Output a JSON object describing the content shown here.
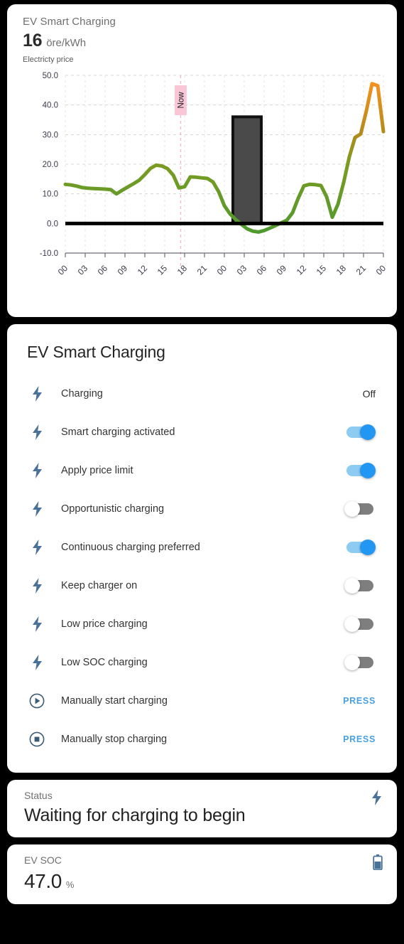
{
  "chart_card": {
    "title": "EV Smart Charging",
    "price_value": "16",
    "price_unit": "öre/kWh",
    "caption": "Electricty price",
    "now_label": "Now"
  },
  "chart_data": {
    "type": "line",
    "title": "Electricty price",
    "xlabel": "",
    "ylabel": "öre/kWh",
    "ylim": [
      -10,
      50
    ],
    "yticks": [
      "50.0",
      "40.0",
      "30.0",
      "20.0",
      "10.0",
      "0.0",
      "-10.0"
    ],
    "ytick_values": [
      50,
      40,
      30,
      20,
      10,
      0,
      -10
    ],
    "xticks": [
      "00",
      "03",
      "06",
      "09",
      "12",
      "15",
      "18",
      "21",
      "00",
      "03",
      "06",
      "09",
      "12",
      "15",
      "18",
      "21",
      "00"
    ],
    "grid": true,
    "legend": "none",
    "line_color_low": "#4f9a2f",
    "line_color_high": "#f5911e",
    "now_marker": {
      "label": "Now",
      "x_hour": "17",
      "line_color": "#f0b6c4",
      "label_bg": "#f9c6d6"
    },
    "charge_bar": {
      "color": "#4a4a4a",
      "edge_color": "#111111",
      "start_hour": "23",
      "end_hour": "03",
      "value": 36
    },
    "series": [
      {
        "name": "Electricity price",
        "x": [
          0,
          1,
          2,
          3,
          4,
          5,
          6,
          7,
          8,
          9,
          10,
          11,
          12,
          13,
          14,
          15,
          16,
          17,
          18,
          19,
          20,
          21,
          22,
          23,
          24,
          25,
          26,
          27,
          28,
          29,
          30,
          31,
          32,
          33,
          34,
          35,
          36,
          37,
          38,
          39,
          40,
          41,
          42,
          43,
          44,
          45,
          46,
          47,
          48
        ],
        "values": [
          13.2,
          13.0,
          12.6,
          12.1,
          11.9,
          11.8,
          11.7,
          11.6,
          11.4,
          10.0,
          11.2,
          12.3,
          13.4,
          14.6,
          16.5,
          18.6,
          19.7,
          19.4,
          18.5,
          16.3,
          12.0,
          12.4,
          15.7,
          15.6,
          15.4,
          15.2,
          14.0,
          10.7,
          6.0,
          3.2,
          1.3,
          -0.3,
          -1.8,
          -2.6,
          -2.9,
          -2.4,
          -1.6,
          -0.7,
          0.2,
          1.1,
          3.6,
          8.5,
          12.7,
          13.2,
          13.1,
          12.8,
          9.0,
          2.1,
          6.5
        ]
      },
      {
        "name": "Electricity price (continued)",
        "x": [
          48,
          49,
          50,
          51,
          52,
          53,
          54,
          55,
          56
        ],
        "values": [
          6.5,
          13.8,
          22.5,
          29.0,
          30.2,
          38.0,
          47.2,
          46.5,
          31.0
        ]
      }
    ]
  },
  "settings_card": {
    "title": "EV Smart Charging",
    "rows": [
      {
        "icon": "lightning-bolt-icon",
        "label": "Charging",
        "control": "text",
        "value": "Off"
      },
      {
        "icon": "lightning-bolt-icon",
        "label": "Smart charging activated",
        "control": "toggle",
        "state": "on"
      },
      {
        "icon": "lightning-bolt-icon",
        "label": "Apply price limit",
        "control": "toggle",
        "state": "on"
      },
      {
        "icon": "lightning-bolt-icon",
        "label": "Opportunistic charging",
        "control": "toggle",
        "state": "off"
      },
      {
        "icon": "lightning-bolt-icon",
        "label": "Continuous charging preferred",
        "control": "toggle",
        "state": "on"
      },
      {
        "icon": "lightning-bolt-icon",
        "label": "Keep charger on",
        "control": "toggle",
        "state": "off"
      },
      {
        "icon": "lightning-bolt-icon",
        "label": "Low price charging",
        "control": "toggle",
        "state": "off"
      },
      {
        "icon": "lightning-bolt-icon",
        "label": "Low SOC charging",
        "control": "toggle",
        "state": "off"
      },
      {
        "icon": "play-circle-icon",
        "label": "Manually start charging",
        "control": "press",
        "value": "PRESS"
      },
      {
        "icon": "stop-circle-icon",
        "label": "Manually stop charging",
        "control": "press",
        "value": "PRESS"
      }
    ]
  },
  "status_card": {
    "label": "Status",
    "value": "Waiting for charging to begin",
    "icon": "lightning-bolt-icon"
  },
  "soc_card": {
    "label": "EV SOC",
    "value": "47.0",
    "unit": "%",
    "icon": "battery-icon"
  },
  "colors": {
    "page_bg": "#000000",
    "card_bg": "#ffffff",
    "icon_blue": "#4a7198",
    "toggle_on": "#2196f3",
    "toggle_on_track": "#8ecbf2",
    "toggle_off_track": "#7e7e7e",
    "link_blue": "#49a0e0",
    "bar_gray": "#4a4a4a"
  }
}
